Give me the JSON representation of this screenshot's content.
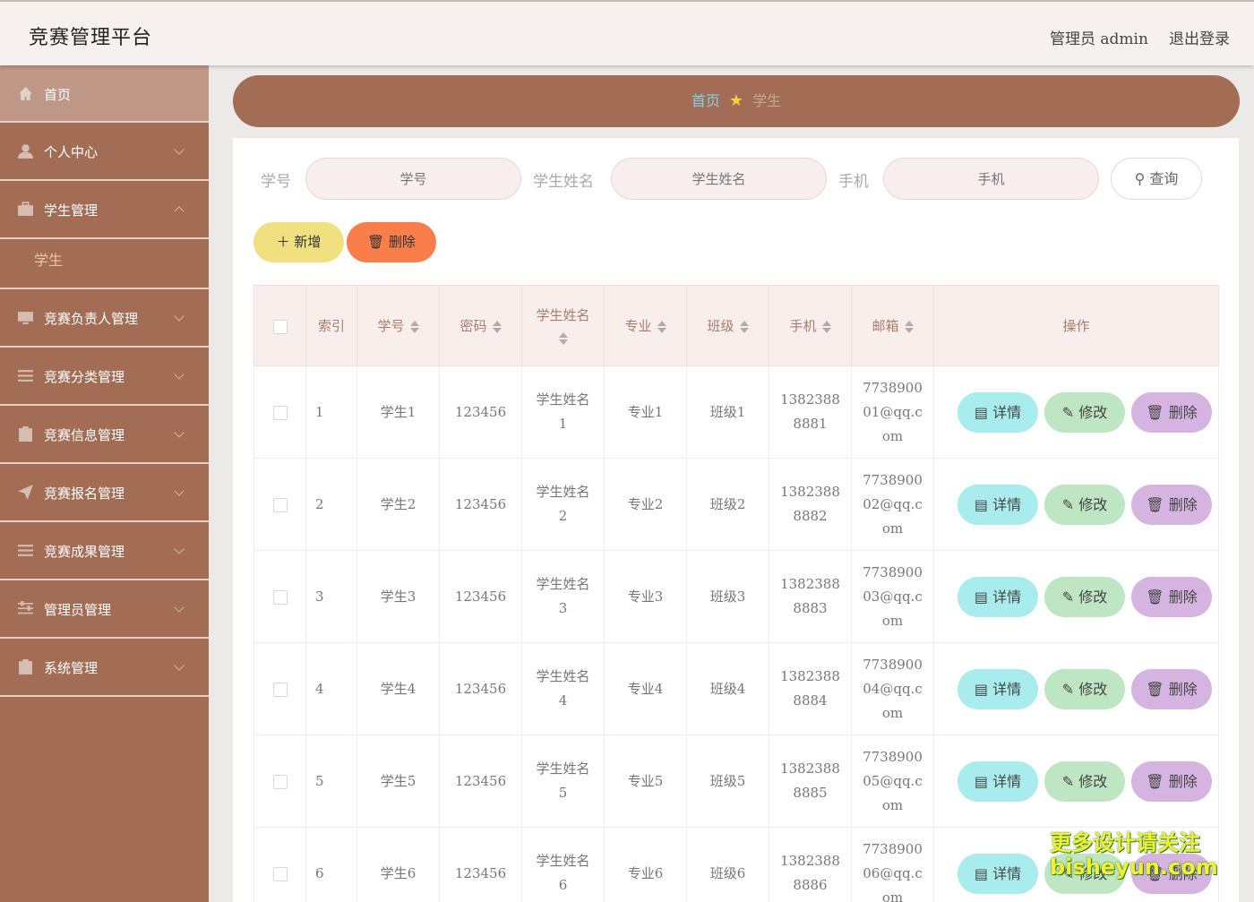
{
  "header": {
    "title": "竞赛管理平台",
    "admin": "管理员 admin",
    "logout": "退出登录"
  },
  "sidebar": {
    "items": [
      {
        "label": "首页",
        "icon": "home-icon"
      },
      {
        "label": "个人中心",
        "icon": "user-icon"
      },
      {
        "label": "学生管理",
        "icon": "briefcase-icon"
      },
      {
        "label": "学生",
        "icon": ""
      },
      {
        "label": "竞赛负责人管理",
        "icon": "monitor-icon"
      },
      {
        "label": "竞赛分类管理",
        "icon": "list-icon"
      },
      {
        "label": "竞赛信息管理",
        "icon": "clipboard-icon"
      },
      {
        "label": "竞赛报名管理",
        "icon": "send-icon"
      },
      {
        "label": "竞赛成果管理",
        "icon": "list-icon"
      },
      {
        "label": "管理员管理",
        "icon": "sliders-icon"
      },
      {
        "label": "系统管理",
        "icon": "clipboard-icon"
      }
    ]
  },
  "breadcrumb": {
    "home": "首页",
    "current": "学生"
  },
  "search": {
    "fields": [
      {
        "label": "学号",
        "placeholder": "学号"
      },
      {
        "label": "学生姓名",
        "placeholder": "学生姓名"
      },
      {
        "label": "手机",
        "placeholder": "手机"
      }
    ],
    "button": "查询"
  },
  "actions": {
    "add": "新增",
    "delete": "删除"
  },
  "table": {
    "headers": [
      "索引",
      "学号",
      "密码",
      "学生姓名",
      "专业",
      "班级",
      "手机",
      "邮箱",
      "操作"
    ],
    "rows": [
      {
        "index": "1",
        "no": "学生1",
        "pwd": "123456",
        "name": "学生姓名1",
        "major": "专业1",
        "class": "班级1",
        "phone": "13823888881",
        "email": "773890001@qq.com"
      },
      {
        "index": "2",
        "no": "学生2",
        "pwd": "123456",
        "name": "学生姓名2",
        "major": "专业2",
        "class": "班级2",
        "phone": "13823888882",
        "email": "773890002@qq.com"
      },
      {
        "index": "3",
        "no": "学生3",
        "pwd": "123456",
        "name": "学生姓名3",
        "major": "专业3",
        "class": "班级3",
        "phone": "13823888883",
        "email": "773890003@qq.com"
      },
      {
        "index": "4",
        "no": "学生4",
        "pwd": "123456",
        "name": "学生姓名4",
        "major": "专业4",
        "class": "班级4",
        "phone": "13823888884",
        "email": "773890004@qq.com"
      },
      {
        "index": "5",
        "no": "学生5",
        "pwd": "123456",
        "name": "学生姓名5",
        "major": "专业5",
        "class": "班级5",
        "phone": "13823888885",
        "email": "773890005@qq.com"
      },
      {
        "index": "6",
        "no": "学生6",
        "pwd": "123456",
        "name": "学生姓名6",
        "major": "专业6",
        "class": "班级6",
        "phone": "13823888886",
        "email": "773890006@qq.com"
      }
    ],
    "row_actions": {
      "detail": "详情",
      "edit": "修改",
      "delete": "删除"
    }
  },
  "watermark": {
    "line1": "更多设计请关注",
    "line2": "bisheyun.com"
  }
}
